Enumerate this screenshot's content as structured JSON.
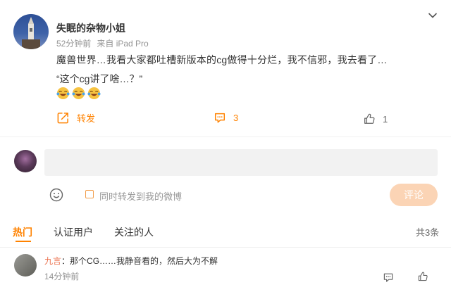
{
  "post": {
    "author": "失眠的杂物小姐",
    "time": "52分钟前",
    "source": "来自 iPad Pro",
    "text_line1": "魔兽世界…我看大家都吐槽新版本的cg做得十分烂，我不信邪，我去看了…",
    "text_line2": "“这个cg讲了啥…？”",
    "emoji_icon": "laughing-crying-emoji"
  },
  "actions": {
    "repost_label": "转发",
    "comment_count": "3",
    "like_count": "1"
  },
  "composer": {
    "also_repost_label": "同时转发到我的微博",
    "submit_label": "评论"
  },
  "tabs": [
    {
      "label": "热门"
    },
    {
      "label": "认证用户"
    },
    {
      "label": "关注的人"
    }
  ],
  "total_label": "共3条",
  "comments": [
    {
      "user": "九言",
      "separator": "：",
      "text": "那个CG……我静音看的，然后大为不解",
      "time": "14分钟前"
    }
  ],
  "colors": {
    "accent": "#ff8200",
    "username_link": "#eb7350",
    "muted": "#939393",
    "submit_disabled": "#fbd4b5"
  }
}
